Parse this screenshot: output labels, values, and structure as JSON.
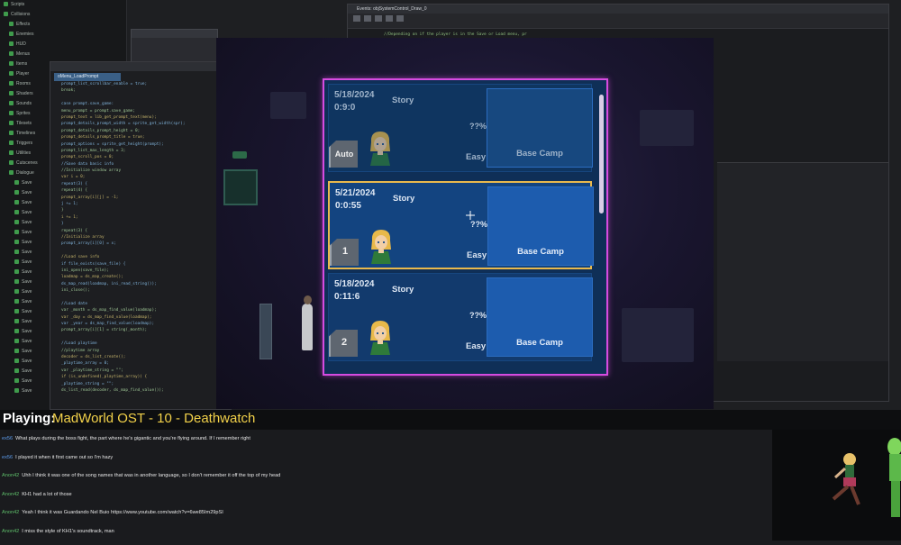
{
  "ide": {
    "tree_items": [
      "Scripts",
      "Collisions",
      "Effects",
      "Enemies",
      "HUD",
      "Menus",
      "Items",
      "Player",
      "Rooms",
      "Shaders",
      "Sounds",
      "Sprites",
      "Tilesets",
      "Timelines",
      "Triggers",
      "Utilities",
      "Cutscenes",
      "Dialogue",
      "Save",
      "Save",
      "Save",
      "Save",
      "Save",
      "Save",
      "Save",
      "Save",
      "Save",
      "Save",
      "Save",
      "Save",
      "Save",
      "Save",
      "Save",
      "Save",
      "Save",
      "Save",
      "Save",
      "Save",
      "Save",
      "Save"
    ],
    "code_lines": [
      "prompt_list_scrollbar_enable = true;",
      "break;",
      "",
      "case prompt.save_game:",
      "  menu_prompt = prompt.save_game;",
      "  prompt_text = lib_get_prompt_text(menu);",
      "  prompt_details_prompt_width = sprite_get_width(spr);",
      "  prompt_details_prompt_height = 0;",
      "  prompt_details_prompt_title = true;",
      "  prompt_options = sprite_get_height(prompt);",
      "  prompt_list_max_length = 3;",
      "  prompt_scroll_pos = 0;",
      "  //Save data basic info",
      "  //Initialize window array",
      "  var i = 0;",
      "  repeat(3) {",
      "    repeat(4) {",
      "      prompt_array[i][j] = -1;",
      "      j += 1;",
      "    }",
      "    i += 1;",
      "  }",
      "  repeat(3) {",
      "    //Initialize array",
      "    prompt_array[i][0] = x;",
      "",
      "    //Load save info",
      "    if file_exists(save_file) {",
      "      ini_open(save_file);",
      "      loadmap = ds_map_create();",
      "      ds_map_read(loadmap, ini_read_string());",
      "      ini_close();",
      "",
      "      //Load date",
      "      var _month = ds_map_find_value(loadmap);",
      "      var _day = ds_map_find_value(loadmap);",
      "      var _year = ds_map_find_value(loadmap);",
      "      prompt_array[i][1] = string(_month);",
      "",
      "      //Load playtime",
      "      //playtime array",
      "      decoder = ds_list_create();",
      "      _playtime_array = 0;",
      "      var _playtime_string = \"\";",
      "      if (is_undefined(_playtime_array)) {",
      "        _playtime_string = \"\";",
      "        ds_list_read(decoder, ds_map_find_value());"
    ],
    "code_tab": "oMenu_LoadPrompt",
    "object_window_title": "Events: objSystemControl_Draw_0",
    "object_code": "//Depending on if the player is in the Save or Load menu, pr"
  },
  "save_panel": {
    "slots": [
      {
        "date": "5/18/2024",
        "time": "0:9:0",
        "mode": "Story",
        "percent": "??%",
        "difficulty": "Easy",
        "location": "Base Camp",
        "badge": "Auto",
        "state": "dim"
      },
      {
        "date": "5/21/2024",
        "time": "0:0:55",
        "mode": "Story",
        "percent": "??%",
        "difficulty": "Easy",
        "location": "Base Camp",
        "badge": "1",
        "state": "selected"
      },
      {
        "date": "5/18/2024",
        "time": "0:11:6",
        "mode": "Story",
        "percent": "??%",
        "difficulty": "Easy",
        "location": "Base Camp",
        "badge": "2",
        "state": "normal"
      }
    ],
    "colors": {
      "border": "#d64be0",
      "selected": "#e9b94d",
      "panel": "#0f2f57"
    }
  },
  "now_playing": {
    "label": "Playing:",
    "song": "MadWorld OST - 10 - Deathwatch"
  },
  "chat": [
    {
      "user": "ex56",
      "message": "What plays during the boss fight, the part where he's gigantic and you're flying around. If I remember right"
    },
    {
      "user": "ex56",
      "message": "I played it when it first came out so I'm hazy"
    },
    {
      "user": "Anon42",
      "message": "Uhh I think it was one of the song names that was in another language, so I don't remember it off the top of my head"
    },
    {
      "user": "Anon42",
      "message": "KH1 had a lot of those"
    },
    {
      "user": "Anon42",
      "message": "Yeah I think it was Guardando Nel Buio https://www.youtube.com/watch?v=6we85Im29pSI"
    },
    {
      "user": "Anon42",
      "message": "I miss the style of KH1's soundtrack, man"
    }
  ]
}
